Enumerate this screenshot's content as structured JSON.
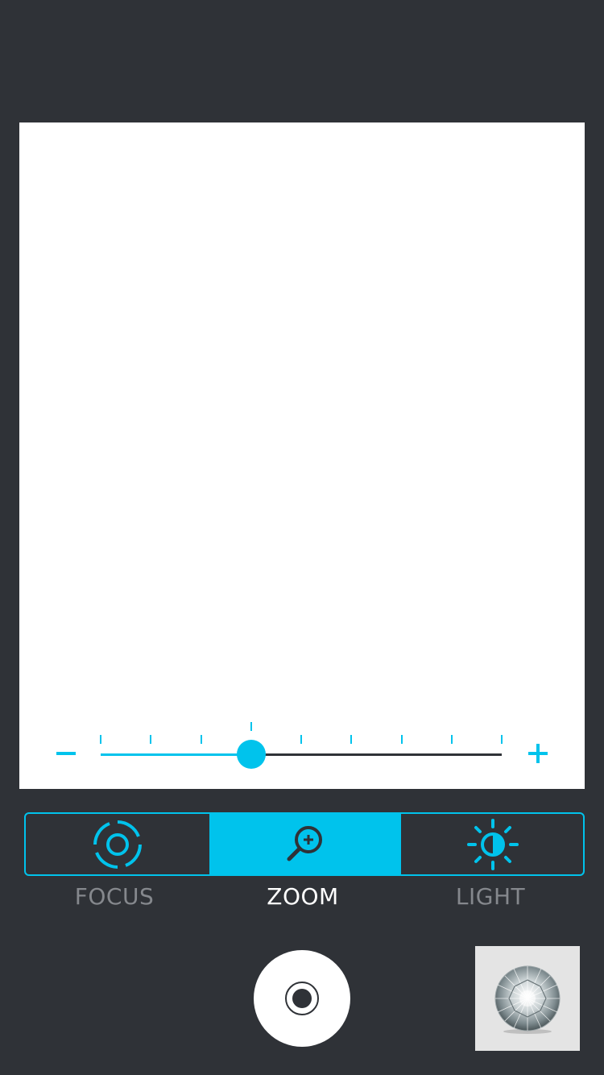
{
  "app": {
    "accent_color": "#00c3ec",
    "background_color": "#2f3237",
    "viewfinder_color": "#ffffff"
  },
  "zoom_slider": {
    "minus_icon": "minus-icon",
    "plus_icon": "plus-icon",
    "tick_count": 9,
    "value_fraction": 0.375
  },
  "mode_tabs": {
    "items": [
      {
        "id": "focus",
        "label": "FOCUS",
        "icon": "focus-target-icon",
        "active": false
      },
      {
        "id": "zoom",
        "label": "ZOOM",
        "icon": "zoom-in-magnifier-icon",
        "active": true
      },
      {
        "id": "light",
        "label": "LIGHT",
        "icon": "brightness-sun-icon",
        "active": false
      }
    ]
  },
  "shutter": {
    "icon": "record-dot-icon"
  },
  "gallery_thumbnail": {
    "subject": "diamond-gem-image"
  }
}
